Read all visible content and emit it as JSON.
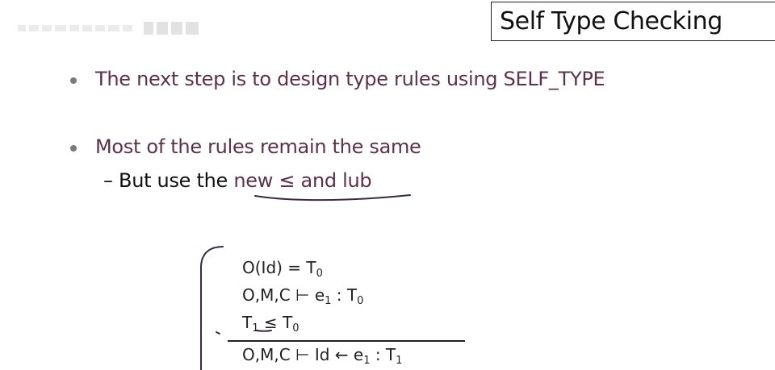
{
  "title": "Self Type Checking",
  "bullets": [
    {
      "text": "The next step is to design type rules using SELF_TYPE"
    },
    {
      "text": "Most of the rules remain the same"
    }
  ],
  "sub_bullet": {
    "dash": "–",
    "prefix": "But use the",
    "new": "new",
    "leq": "≤",
    "and": "and",
    "lub": "lub"
  },
  "rule": {
    "premise1": {
      "lhs": "O(Id) = T",
      "sub": "0"
    },
    "premise2": {
      "lhs": "O,M,C ⊢ e",
      "sub1": "1",
      "mid": " : T",
      "sub2": "0"
    },
    "premise3": {
      "t1": "T",
      "sub1": "1",
      "leq": "≤",
      "t0": "T",
      "sub2": "0"
    },
    "conclusion": {
      "lhs": "O,M,C ⊢ Id ← e",
      "sub1": "1",
      "mid": " : T",
      "sub2": "1"
    }
  },
  "colors": {
    "bullet_text": "#60304a",
    "ink": "#3a2a44",
    "title_border": "#222222"
  }
}
